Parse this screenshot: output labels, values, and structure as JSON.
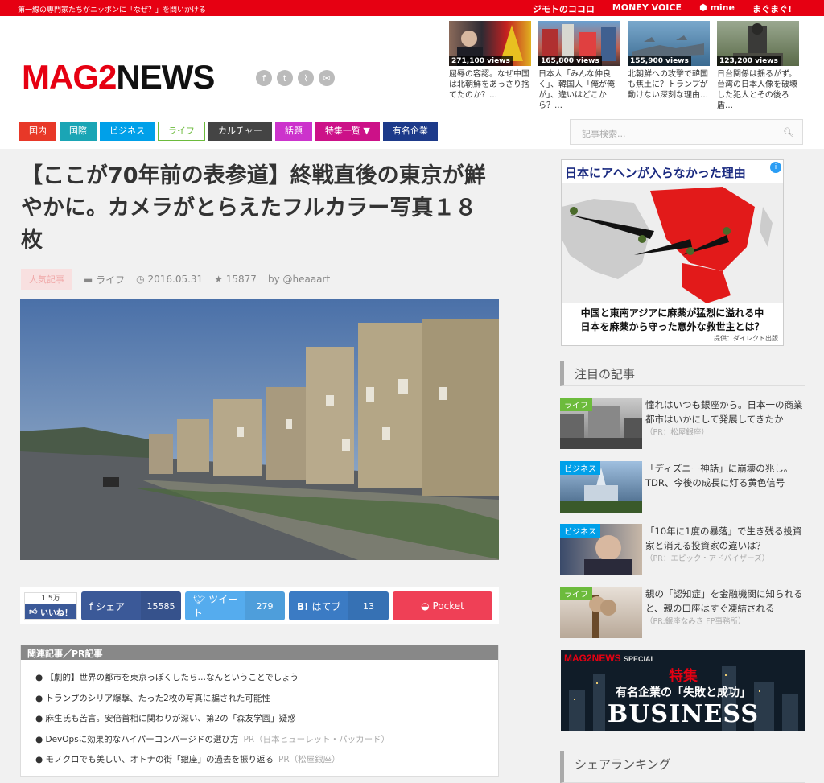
{
  "topbar": {
    "tagline": "第一線の専門家たちがニッポンに「なぜ？」を問いかける",
    "links": [
      "ジモトのココロ",
      "MONEY VOICE",
      "mine",
      "まぐまぐ!"
    ]
  },
  "logo": {
    "part1": "MAG2",
    "part2": "NEWS"
  },
  "social_icons": [
    "facebook-icon",
    "twitter-icon",
    "rss-icon",
    "mail-icon"
  ],
  "hot": [
    {
      "views": "271,100 views",
      "caption": "屈辱の容認。なぜ中国は北朝鮮をあっさり捨てたのか？…"
    },
    {
      "views": "165,800 views",
      "caption": "日本人「みんな仲良く」、韓国人「俺が俺が」、違いはどこから？…"
    },
    {
      "views": "155,900 views",
      "caption": "北朝鮮への攻撃で韓国も焦土に？トランプが動けない深刻な理由…"
    },
    {
      "views": "123,200 views",
      "caption": "日台関係は揺るがず。台湾の日本人像を破壊した犯人とその後ろ盾…"
    }
  ],
  "nav": [
    {
      "label": "国内",
      "color": "#e83828"
    },
    {
      "label": "国際",
      "color": "#1aa5b5"
    },
    {
      "label": "ビジネス",
      "color": "#00a0e9"
    },
    {
      "label": "ライフ",
      "color": "#ffffff"
    },
    {
      "label": "カルチャー",
      "color": "#444444"
    },
    {
      "label": "話題",
      "color": "#cc33cc"
    },
    {
      "label": "特集一覧 ▼",
      "color": "#cc1188"
    },
    {
      "label": "有名企業",
      "color": "#1d3a8a"
    }
  ],
  "search": {
    "placeholder": "記事検索...",
    "icon": "search-icon"
  },
  "article": {
    "title": "【ここが70年前の表参道】終戦直後の東京が鮮やかに。カメラがとらえたフルカラー写真１８枚",
    "badge": "人気記事",
    "category": "ライフ",
    "date": "2016.05.31",
    "stars": "15877",
    "author": "by @heaaart"
  },
  "share": {
    "like_count": "1.5万",
    "like_label": "いいね！",
    "facebook": {
      "label": "シェア",
      "count": "15585"
    },
    "twitter": {
      "label": "ツイート",
      "count": "279"
    },
    "hatena": {
      "label": "はてブ",
      "count": "13"
    },
    "pocket": {
      "label": "Pocket"
    }
  },
  "related": {
    "heading": "関連記事／PR記事",
    "items": [
      {
        "text": "【劇的】世界の都市を東京っぽくしたら…なんということでしょう",
        "pr": ""
      },
      {
        "text": "トランプのシリア爆撃、たった2枚の写真に騙された可能性",
        "pr": ""
      },
      {
        "text": "麻生氏も苦言。安倍首相に関わりが深い、第2の「森友学園」疑惑",
        "pr": ""
      },
      {
        "text": "DevOpsに効果的なハイパーコンバージドの選び方",
        "pr": "PR（日本ヒューレット・パッカード）"
      },
      {
        "text": "モノクロでも美しい、オトナの街「銀座」の過去を振り返る",
        "pr": "PR（松屋銀座）"
      }
    ]
  },
  "ad": {
    "headline": "日本にアヘンが入らなかった理由",
    "caption": "中国と東南アジアに麻薬が猛烈に溢れる中\n日本を麻薬から守った意外な救世主とは？",
    "credit": "提供：ダイレクト出版"
  },
  "featured": {
    "heading": "注目の記事",
    "items": [
      {
        "label": "ライフ",
        "labelColor": "#6cbb3c",
        "text": "憧れはいつも銀座から。日本一の商業都市はいかにして発展してきたか",
        "pr": "（PR：松屋銀座）"
      },
      {
        "label": "ビジネス",
        "labelColor": "#00a0e9",
        "text": "「ディズニー神話」に崩壊の兆し。TDR、今後の成長に灯る黄色信号",
        "pr": ""
      },
      {
        "label": "ビジネス",
        "labelColor": "#00a0e9",
        "text": "「10年に1度の暴落」で生き残る投資家と消える投資家の違いは？",
        "pr": "（PR：エピック・アドバイザーズ）"
      },
      {
        "label": "ライフ",
        "labelColor": "#6cbb3c",
        "text": "親の「認知症」を金融機関に知られると、親の口座はすぐ凍結される",
        "pr": "（PR:銀座なみき FP事務所）"
      }
    ]
  },
  "special": {
    "brand": "MAG2NEWS",
    "brand_sub": "SPECIAL",
    "feature": "特集",
    "sub": "有名企業の「失敗と成功」",
    "title": "BUSINESS"
  },
  "ranking": {
    "heading": "シェアランキング"
  }
}
